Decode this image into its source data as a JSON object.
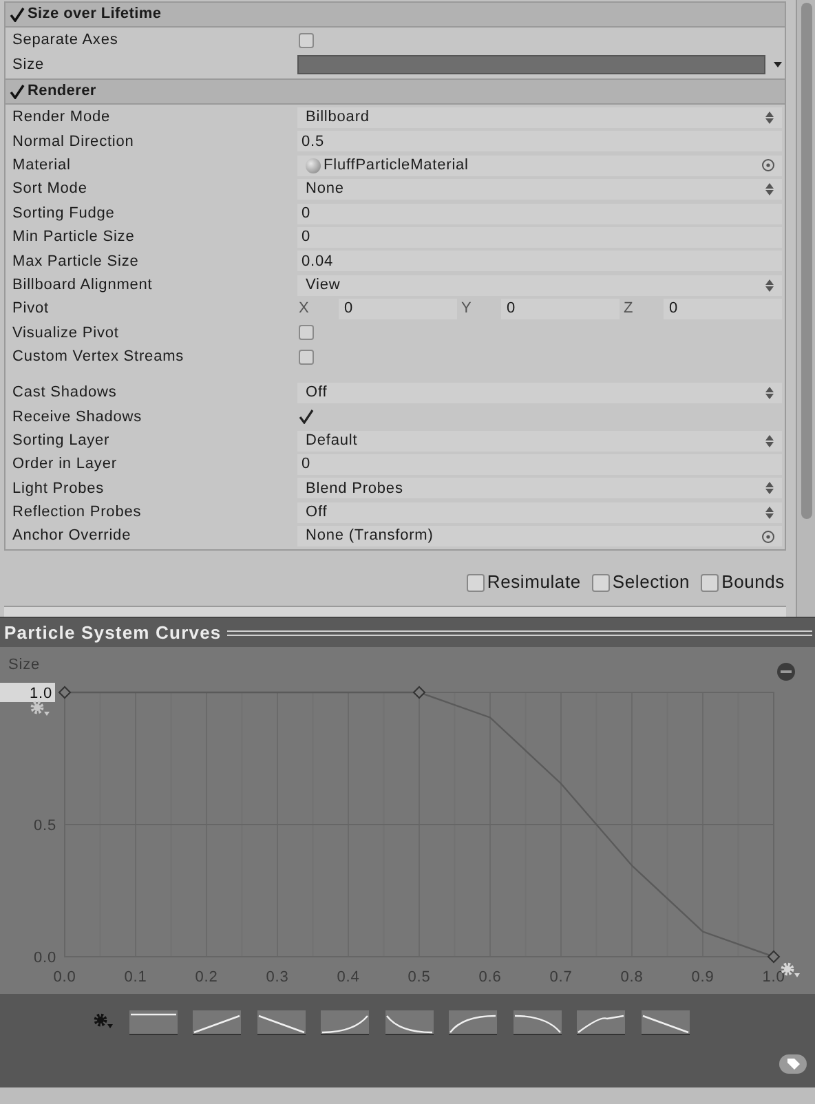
{
  "inspector": {
    "modules": [
      {
        "title": "Size over Lifetime",
        "enabled": true,
        "rows": [
          {
            "kind": "checkbox",
            "label": "Separate Axes",
            "checked": false
          },
          {
            "kind": "curve",
            "label": "Size"
          }
        ]
      },
      {
        "title": "Renderer",
        "enabled": true,
        "rows": [
          {
            "kind": "dropdown",
            "label": "Render Mode",
            "value": "Billboard"
          },
          {
            "kind": "number",
            "label": "Normal Direction",
            "value": "0.5"
          },
          {
            "kind": "asset",
            "label": "Material",
            "value": "FluffParticleMaterial"
          },
          {
            "kind": "dropdown",
            "label": "Sort Mode",
            "value": "None"
          },
          {
            "kind": "number",
            "label": "Sorting Fudge",
            "value": "0"
          },
          {
            "kind": "number",
            "label": "Min Particle Size",
            "value": "0"
          },
          {
            "kind": "number",
            "label": "Max Particle Size",
            "value": "0.04"
          },
          {
            "kind": "dropdown",
            "label": "Billboard Alignment",
            "value": "View"
          },
          {
            "kind": "vector",
            "label": "Pivot",
            "axes": [
              {
                "axis": "X",
                "value": "0"
              },
              {
                "axis": "Y",
                "value": "0"
              },
              {
                "axis": "Z",
                "value": "0"
              }
            ]
          },
          {
            "kind": "checkbox",
            "label": "Visualize Pivot",
            "checked": false
          },
          {
            "kind": "checkbox",
            "label": "Custom Vertex Streams",
            "checked": false
          },
          {
            "kind": "dropdown",
            "label": "Cast Shadows",
            "value": "Off",
            "gap_before": true
          },
          {
            "kind": "checkbox",
            "label": "Receive Shadows",
            "checked": true
          },
          {
            "kind": "dropdown",
            "label": "Sorting Layer",
            "value": "Default"
          },
          {
            "kind": "number",
            "label": "Order in Layer",
            "value": "0"
          },
          {
            "kind": "dropdown",
            "label": "Light Probes",
            "value": "Blend Probes"
          },
          {
            "kind": "dropdown",
            "label": "Reflection Probes",
            "value": "Off"
          },
          {
            "kind": "object",
            "label": "Anchor Override",
            "value": "None (Transform)"
          }
        ]
      }
    ]
  },
  "preview_toggles": [
    {
      "label": "Resimulate",
      "checked": false
    },
    {
      "label": "Selection",
      "checked": false
    },
    {
      "label": "Bounds",
      "checked": false
    }
  ],
  "curves_panel": {
    "title": "Particle System Curves",
    "chart_data": {
      "type": "line",
      "grid": true,
      "ref_lines": [
        {
          "axis": "y",
          "value": 0.5
        }
      ],
      "x": [
        0,
        0.5,
        0.6,
        0.7,
        0.8,
        0.9,
        1.0
      ],
      "series": [
        {
          "name": "Size",
          "color": "#5a5a5a",
          "values": [
            1,
            1,
            0.905,
            0.655,
            0.345,
            0.095,
            0
          ]
        }
      ],
      "xlim": [
        0,
        1
      ],
      "ylim": [
        0,
        1
      ],
      "xticks": [
        {
          "value": 0,
          "label": "0.0"
        },
        0.1,
        0.2,
        0.3,
        0.4,
        0.5,
        0.6,
        0.7,
        0.8,
        0.9,
        {
          "value": 1,
          "label": "1.0"
        }
      ],
      "yticks": [
        {
          "value": 0,
          "label": "0.0"
        },
        0.5,
        {
          "value": 1,
          "label": "1.0"
        }
      ]
    }
  }
}
